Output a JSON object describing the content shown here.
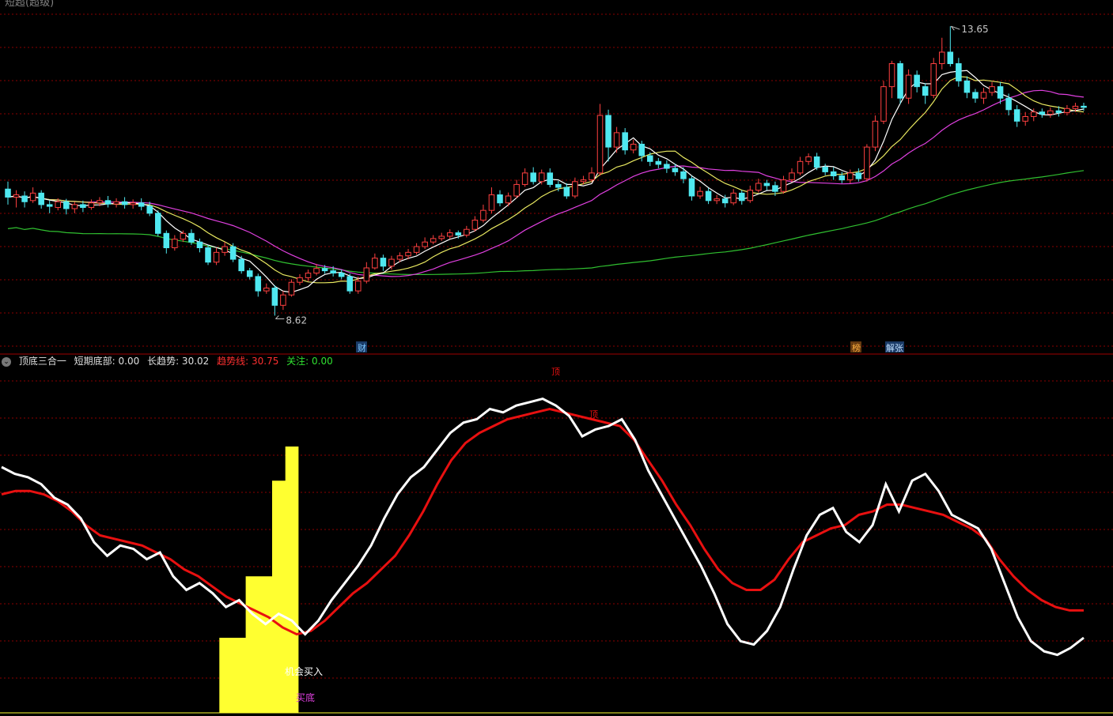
{
  "top_title": "短超(超级)",
  "indicator_bar": {
    "name": "顶底三合一",
    "f1": "短期底部: 0.00",
    "f2": "长趋势: 30.02",
    "f3": "趋势线: 30.75",
    "f4": "关注: 0.00"
  },
  "colors": {
    "bg": "#000000",
    "grid": "#8b0000",
    "up": "#ff4040",
    "down": "#4fe8f0",
    "ma_fast": "#ffffff",
    "ma_yellow": "#e8e860",
    "ma_magenta": "#e040e0",
    "ma_green": "#30c030",
    "long_trend": "#ffffff",
    "trend_line": "#e81010",
    "bottom_fill": "#ffff30"
  },
  "markers": {
    "high_label": "13.65",
    "low_label": "8.62",
    "tag_cai": "财",
    "tag_bang": "榜",
    "tag_jiezhang": "解张",
    "top_signal": "顶",
    "buy_label": "买底",
    "chance_label": "机会买入"
  },
  "chart_data": [
    {
      "type": "candlestick",
      "title": "",
      "ylim": [
        8.2,
        13.9
      ],
      "high": 13.65,
      "low": 8.62,
      "candles": [
        [
          10.82,
          10.68,
          10.95,
          10.55
        ],
        [
          10.68,
          10.72,
          10.8,
          10.5
        ],
        [
          10.7,
          10.6,
          10.78,
          10.5
        ],
        [
          10.62,
          10.75,
          10.85,
          10.58
        ],
        [
          10.75,
          10.55,
          10.8,
          10.48
        ],
        [
          10.55,
          10.52,
          10.62,
          10.4
        ],
        [
          10.5,
          10.6,
          10.66,
          10.45
        ],
        [
          10.6,
          10.48,
          10.65,
          10.38
        ],
        [
          10.48,
          10.55,
          10.6,
          10.4
        ],
        [
          10.55,
          10.5,
          10.62,
          10.42
        ],
        [
          10.5,
          10.58,
          10.64,
          10.46
        ],
        [
          10.58,
          10.62,
          10.68,
          10.52
        ],
        [
          10.62,
          10.56,
          10.7,
          10.5
        ],
        [
          10.56,
          10.6,
          10.66,
          10.5
        ],
        [
          10.6,
          10.55,
          10.68,
          10.48
        ],
        [
          10.55,
          10.58,
          10.64,
          10.48
        ],
        [
          10.58,
          10.52,
          10.66,
          10.45
        ],
        [
          10.52,
          10.4,
          10.6,
          10.35
        ],
        [
          10.4,
          10.05,
          10.45,
          10.0
        ],
        [
          10.05,
          9.8,
          10.1,
          9.7
        ],
        [
          9.8,
          9.95,
          10.02,
          9.75
        ],
        [
          9.95,
          10.05,
          10.1,
          9.9
        ],
        [
          10.05,
          9.9,
          10.12,
          9.85
        ],
        [
          9.9,
          9.8,
          9.96,
          9.72
        ],
        [
          9.8,
          9.55,
          9.85,
          9.5
        ],
        [
          9.55,
          9.72,
          9.8,
          9.5
        ],
        [
          9.72,
          9.82,
          9.9,
          9.66
        ],
        [
          9.82,
          9.6,
          9.88,
          9.55
        ],
        [
          9.6,
          9.4,
          9.66,
          9.35
        ],
        [
          9.4,
          9.3,
          9.45,
          9.25
        ],
        [
          9.3,
          9.05,
          9.35,
          8.95
        ],
        [
          9.05,
          9.1,
          9.18,
          9.0
        ],
        [
          9.1,
          8.8,
          9.15,
          8.62
        ],
        [
          8.8,
          8.98,
          9.05,
          8.72
        ],
        [
          8.98,
          9.2,
          9.25,
          8.95
        ],
        [
          9.2,
          9.28,
          9.34,
          9.15
        ],
        [
          9.28,
          9.36,
          9.42,
          9.22
        ],
        [
          9.36,
          9.44,
          9.52,
          9.32
        ],
        [
          9.44,
          9.4,
          9.5,
          9.35
        ],
        [
          9.4,
          9.36,
          9.48,
          9.3
        ],
        [
          9.36,
          9.3,
          9.42,
          9.25
        ],
        [
          9.3,
          9.05,
          9.35,
          9.0
        ],
        [
          9.05,
          9.22,
          9.3,
          9.0
        ],
        [
          9.22,
          9.45,
          9.55,
          9.18
        ],
        [
          9.45,
          9.62,
          9.7,
          9.42
        ],
        [
          9.62,
          9.48,
          9.68,
          9.4
        ],
        [
          9.48,
          9.6,
          9.66,
          9.42
        ],
        [
          9.6,
          9.66,
          9.72,
          9.55
        ],
        [
          9.66,
          9.72,
          9.78,
          9.6
        ],
        [
          9.72,
          9.82,
          9.88,
          9.68
        ],
        [
          9.82,
          9.9,
          9.98,
          9.78
        ],
        [
          9.9,
          9.96,
          10.02,
          9.86
        ],
        [
          9.96,
          10.0,
          10.06,
          9.92
        ],
        [
          10.0,
          10.06,
          10.12,
          9.95
        ],
        [
          10.06,
          10.02,
          10.1,
          9.96
        ],
        [
          10.02,
          10.12,
          10.18,
          9.98
        ],
        [
          10.12,
          10.28,
          10.35,
          10.08
        ],
        [
          10.28,
          10.45,
          10.55,
          10.24
        ],
        [
          10.45,
          10.72,
          10.85,
          10.4
        ],
        [
          10.72,
          10.58,
          10.8,
          10.52
        ],
        [
          10.58,
          10.7,
          10.76,
          10.52
        ],
        [
          10.7,
          10.9,
          10.98,
          10.66
        ],
        [
          10.9,
          11.1,
          11.18,
          10.86
        ],
        [
          11.1,
          10.95,
          11.2,
          10.9
        ],
        [
          10.95,
          11.1,
          11.16,
          10.9
        ],
        [
          11.1,
          10.9,
          11.18,
          10.85
        ],
        [
          10.9,
          10.85,
          10.96,
          10.78
        ],
        [
          10.85,
          10.7,
          10.92,
          10.65
        ],
        [
          10.7,
          10.95,
          11.02,
          10.66
        ],
        [
          10.95,
          10.98,
          11.05,
          10.9
        ],
        [
          10.98,
          11.1,
          11.2,
          10.94
        ],
        [
          11.1,
          12.1,
          12.3,
          11.05
        ],
        [
          12.1,
          11.55,
          12.2,
          11.3
        ],
        [
          11.55,
          11.8,
          11.9,
          11.45
        ],
        [
          11.8,
          11.5,
          11.88,
          11.42
        ],
        [
          11.5,
          11.6,
          11.68,
          11.44
        ],
        [
          11.6,
          11.4,
          11.66,
          11.3
        ],
        [
          11.4,
          11.3,
          11.46,
          11.22
        ],
        [
          11.3,
          11.25,
          11.36,
          11.18
        ],
        [
          11.25,
          11.18,
          11.32,
          11.1
        ],
        [
          11.18,
          11.12,
          11.26,
          11.05
        ],
        [
          11.12,
          11.0,
          11.2,
          10.92
        ],
        [
          11.0,
          10.7,
          11.05,
          10.62
        ],
        [
          10.7,
          10.78,
          10.86,
          10.65
        ],
        [
          10.78,
          10.62,
          10.84,
          10.56
        ],
        [
          10.62,
          10.65,
          10.72,
          10.56
        ],
        [
          10.65,
          10.58,
          10.72,
          10.5
        ],
        [
          10.58,
          10.75,
          10.82,
          10.54
        ],
        [
          10.75,
          10.62,
          10.8,
          10.55
        ],
        [
          10.62,
          10.8,
          10.88,
          10.58
        ],
        [
          10.8,
          10.92,
          11.0,
          10.76
        ],
        [
          10.92,
          10.88,
          10.98,
          10.8
        ],
        [
          10.88,
          10.78,
          10.95,
          10.7
        ],
        [
          10.78,
          10.98,
          11.05,
          10.74
        ],
        [
          10.98,
          11.1,
          11.18,
          10.94
        ],
        [
          11.1,
          11.3,
          11.38,
          11.06
        ],
        [
          11.3,
          11.38,
          11.44,
          11.24
        ],
        [
          11.38,
          11.2,
          11.45,
          11.15
        ],
        [
          11.2,
          11.12,
          11.26,
          11.06
        ],
        [
          11.12,
          11.05,
          11.2,
          10.98
        ],
        [
          11.05,
          10.98,
          11.12,
          10.92
        ],
        [
          10.98,
          11.1,
          11.16,
          10.92
        ],
        [
          11.1,
          11.0,
          11.18,
          10.95
        ],
        [
          11.0,
          11.55,
          11.6,
          10.95
        ],
        [
          11.55,
          12.0,
          12.1,
          11.48
        ],
        [
          12.0,
          12.6,
          12.7,
          11.95
        ],
        [
          12.6,
          13.0,
          13.05,
          12.4
        ],
        [
          13.0,
          12.4,
          13.05,
          12.3
        ],
        [
          12.4,
          12.8,
          12.9,
          12.3
        ],
        [
          12.8,
          12.6,
          12.88,
          12.5
        ],
        [
          12.6,
          12.45,
          12.66,
          12.3
        ],
        [
          12.45,
          13.0,
          13.1,
          12.4
        ],
        [
          13.0,
          13.2,
          13.45,
          12.9
        ],
        [
          13.2,
          13.0,
          13.65,
          12.95
        ],
        [
          13.0,
          12.7,
          13.1,
          12.6
        ],
        [
          12.7,
          12.5,
          12.78,
          12.4
        ],
        [
          12.5,
          12.4,
          12.56,
          12.32
        ],
        [
          12.4,
          12.5,
          12.58,
          12.3
        ],
        [
          12.5,
          12.6,
          12.68,
          12.44
        ],
        [
          12.6,
          12.4,
          12.68,
          12.3
        ],
        [
          12.4,
          12.2,
          12.48,
          12.1
        ],
        [
          12.2,
          12.0,
          12.28,
          11.9
        ],
        [
          12.0,
          12.08,
          12.16,
          11.92
        ],
        [
          12.08,
          12.16,
          12.22,
          12.0
        ],
        [
          12.16,
          12.12,
          12.22,
          12.06
        ],
        [
          12.12,
          12.18,
          12.24,
          12.06
        ],
        [
          12.18,
          12.15,
          12.26,
          12.08
        ],
        [
          12.15,
          12.22,
          12.28,
          12.1
        ],
        [
          12.22,
          12.26,
          12.32,
          12.16
        ],
        [
          12.26,
          12.24,
          12.32,
          12.18
        ]
      ]
    },
    {
      "type": "line",
      "title": "",
      "ylim": [
        0,
        100
      ],
      "series": [
        {
          "name": "长趋势",
          "values": [
            72,
            70,
            69,
            67,
            63,
            61,
            57,
            50,
            46,
            49,
            48,
            45,
            47,
            40,
            36,
            38,
            35,
            31,
            33,
            29,
            26,
            29,
            27,
            23,
            27,
            33,
            38,
            43,
            49,
            57,
            64,
            69,
            72,
            77,
            82,
            85,
            86,
            89,
            88,
            90,
            91,
            92,
            90,
            87,
            81,
            83,
            84,
            86,
            80,
            71,
            64,
            57,
            50,
            43,
            35,
            26,
            21,
            20,
            24,
            31,
            42,
            52,
            58,
            60,
            53,
            50,
            55,
            67,
            59,
            68,
            70,
            65,
            58,
            56,
            54,
            48,
            38,
            28,
            21,
            18,
            17,
            19,
            22
          ]
        },
        {
          "name": "趋势线",
          "values": [
            64,
            65,
            65,
            64,
            62,
            59,
            55,
            52,
            51,
            50,
            49,
            47,
            45,
            42,
            40,
            37,
            34,
            32,
            30,
            28,
            25,
            23,
            24,
            27,
            31,
            35,
            38,
            42,
            46,
            52,
            59,
            67,
            74,
            79,
            82,
            84,
            86,
            87,
            88,
            89,
            88,
            87,
            86,
            85,
            84,
            80,
            74,
            68,
            61,
            55,
            48,
            42,
            38,
            36,
            36,
            39,
            45,
            50,
            52,
            54,
            55,
            58,
            59,
            61,
            61,
            60,
            59,
            58,
            56,
            54,
            51,
            45,
            40,
            36,
            33,
            31,
            30,
            30
          ]
        },
        {
          "name": "短期底部",
          "values": [
            0,
            0,
            0,
            0,
            0,
            0,
            0,
            0,
            0,
            0,
            0,
            0,
            0,
            0,
            0,
            0,
            0,
            22,
            22,
            40,
            40,
            68,
            78,
            0,
            0,
            0,
            0,
            0,
            0,
            0,
            0,
            0,
            0,
            0,
            0,
            0,
            0,
            0,
            0,
            0,
            0,
            0,
            0,
            0,
            0,
            0,
            0,
            0,
            0,
            0,
            0,
            0,
            0,
            0,
            0,
            0,
            0,
            0,
            0,
            0,
            0,
            0,
            0,
            0,
            0,
            0,
            0,
            0,
            0,
            0,
            0,
            0,
            0,
            0,
            0,
            0,
            0,
            0,
            0,
            0,
            0,
            0,
            0
          ]
        }
      ]
    }
  ]
}
